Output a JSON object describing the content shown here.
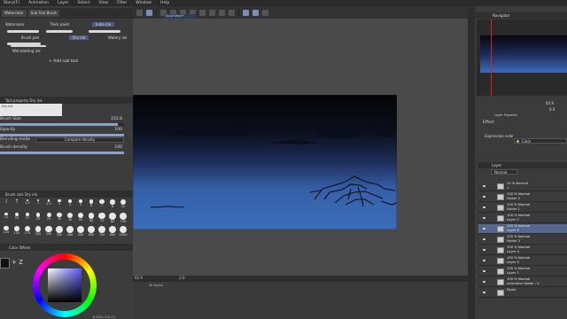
{
  "menu": [
    "Story(F)",
    "Animation",
    "Layer",
    "Select",
    "View",
    "Filter",
    "Window",
    "Help"
  ],
  "sub_tool": {
    "tabs": [
      "Watercolor",
      "Sub Tool Brush"
    ],
    "brushes": [
      "Watercolor",
      "Thick paint",
      "India ink",
      "Brush pen",
      "Dry ink",
      "Watery ink",
      "Wet blotting ink"
    ],
    "add_label": "Add sub tool"
  },
  "tool_property": {
    "header": "Tool property Dry ink",
    "preview_label": "Dry ink",
    "brush_size": {
      "label": "Brush Size",
      "value": "215.8",
      "fraction": 0.95
    },
    "opacity": {
      "label": "Opacity",
      "value": "100",
      "fraction": 1.0
    },
    "blending_mode": {
      "label": "Blending mode",
      "value": "Compare density"
    },
    "brush_density": {
      "label": "Brush density",
      "value": "100",
      "fraction": 1.0
    }
  },
  "brush_size_palette": {
    "header": "Brush size Dry ink",
    "rows": [
      [
        "1",
        "1",
        "1.5",
        "2",
        "2.5",
        "3",
        "4",
        "5",
        "6",
        "7",
        "8",
        "10"
      ],
      [
        "12",
        "15",
        "17",
        "20",
        "25",
        "30",
        "40",
        "50",
        "60",
        "70",
        "80",
        "100"
      ],
      [
        "120",
        "150",
        "170",
        "200",
        "250",
        "300",
        "400",
        "500",
        "600",
        "700",
        "800",
        "1000"
      ]
    ]
  },
  "color_wheel": {
    "header": "Color Wheel",
    "swap_label": "+ Z"
  },
  "canvas": {
    "doc_tab": "Illustration*"
  },
  "status": {
    "zoom": "62.9",
    "zoom_bottom": "2.0",
    "coords": "0.223 / 0.0 / 0"
  },
  "timeline": {
    "tab": "All layers"
  },
  "navigator": {
    "header": "Navigator",
    "zoom": "62.9",
    "rotate": "0.0"
  },
  "layer_property": {
    "header": "Layer Property",
    "effect": "Effect",
    "expression_label": "Expression color",
    "expression_value": "Color"
  },
  "layers_panel": {
    "header": "Layer",
    "blend": "Normal",
    "items": [
      {
        "l1": "25 % Normal",
        "l2": "1",
        "selected": false
      },
      {
        "l1": "100 % Normal",
        "l2": "Folder 2",
        "selected": false
      },
      {
        "l1": "100 % Normal",
        "l2": "Folder 1",
        "selected": false
      },
      {
        "l1": "100 % Normal",
        "l2": "Layer 2",
        "selected": false
      },
      {
        "l1": "100 % Normal",
        "l2": "Layer 6",
        "selected": true
      },
      {
        "l1": "100 % Normal",
        "l2": "Folder 3",
        "selected": false
      },
      {
        "l1": "100 % Normal",
        "l2": "Layer 4",
        "selected": false
      },
      {
        "l1": "100 % Normal",
        "l2": "Layer 5",
        "selected": false
      },
      {
        "l1": "100 % Normal",
        "l2": "Layer 1",
        "selected": false
      },
      {
        "l1": "100 % Normal",
        "l2": "Animation folder : 0",
        "selected": false
      },
      {
        "l1": "",
        "l2": "Paper",
        "selected": false
      }
    ]
  },
  "colors": {
    "accent": "#8ea0c8",
    "selected_layer": "#55678e",
    "sky_bottom": "#3b6dba",
    "sky_top": "#050507"
  }
}
